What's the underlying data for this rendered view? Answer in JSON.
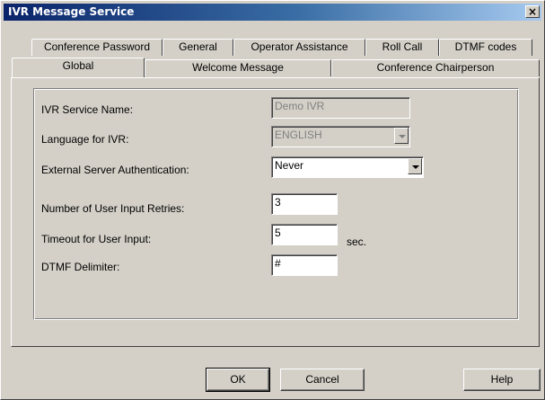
{
  "window": {
    "title": "IVR Message Service",
    "close_glyph": "×"
  },
  "tabs_back": [
    {
      "label": "Conference Password"
    },
    {
      "label": "General"
    },
    {
      "label": "Operator Assistance"
    },
    {
      "label": "Roll Call"
    },
    {
      "label": "DTMF codes"
    }
  ],
  "tabs_front": [
    {
      "label": "Global",
      "active": true
    },
    {
      "label": "Welcome Message"
    },
    {
      "label": "Conference Chairperson"
    }
  ],
  "form": {
    "service_name": {
      "label": "IVR Service Name:",
      "value": "Demo IVR",
      "disabled": true
    },
    "language": {
      "label": "Language for IVR:",
      "value": "ENGLISH",
      "disabled": true
    },
    "ext_auth": {
      "label": "External Server Authentication:",
      "value": "Never"
    },
    "retries": {
      "label": "Number of User Input Retries:",
      "value": "3"
    },
    "timeout": {
      "label": "Timeout for User Input:",
      "value": "5",
      "unit": "sec."
    },
    "delimiter": {
      "label": "DTMF Delimiter:",
      "value": "#"
    }
  },
  "buttons": {
    "ok": "OK",
    "cancel": "Cancel",
    "help": "Help"
  }
}
